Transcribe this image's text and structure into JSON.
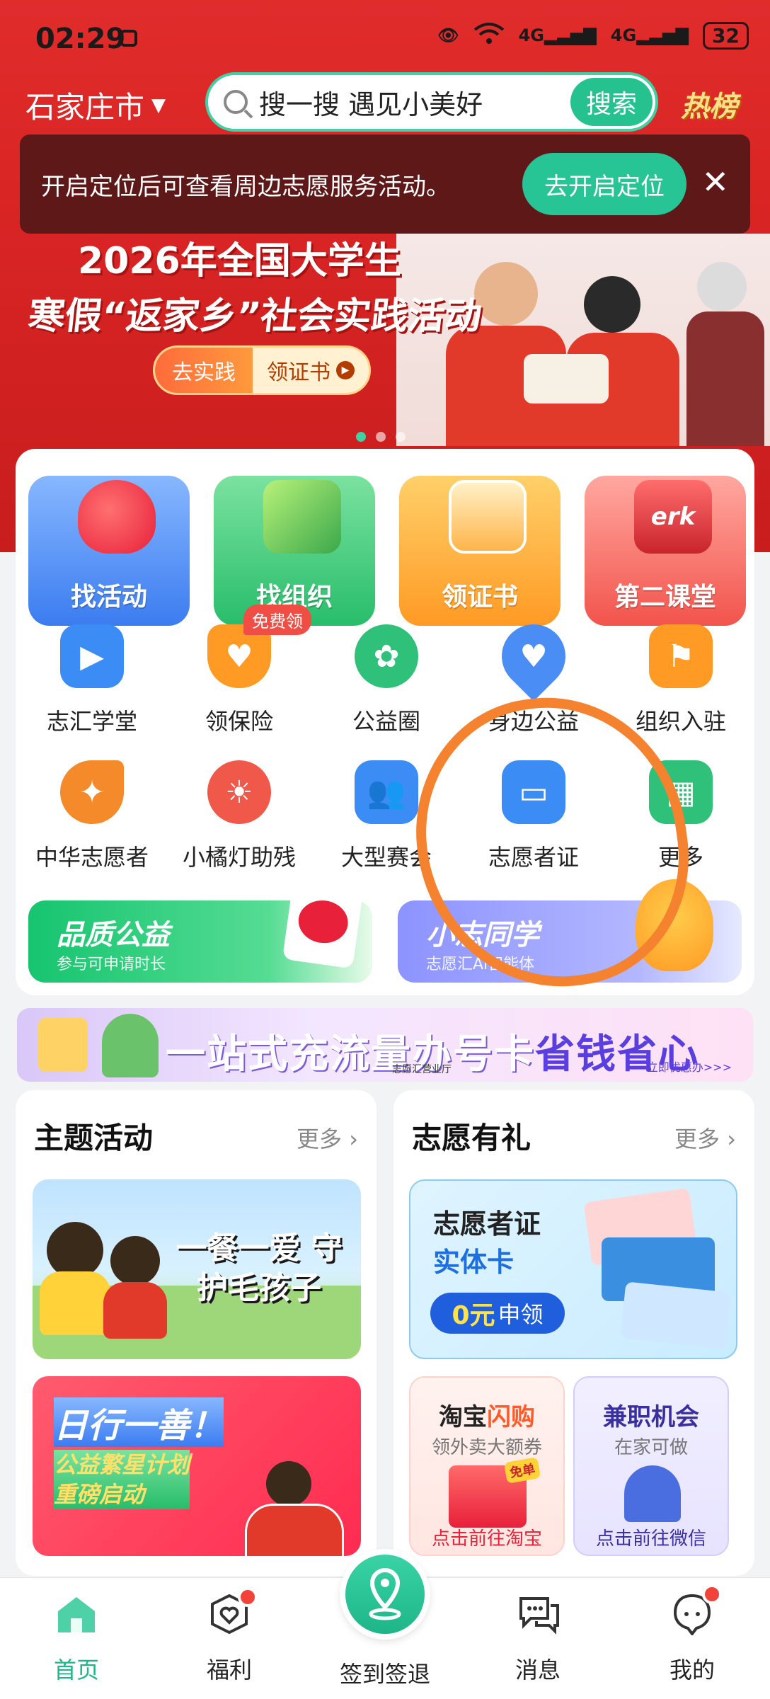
{
  "status": {
    "time": "02:29",
    "network": "4G",
    "battery": "32"
  },
  "header": {
    "city": "石家庄市",
    "search_placeholder": "搜一搜 遇见小美好",
    "search_button": "搜索",
    "hot_label": "热榜"
  },
  "notice": {
    "text": "开启定位后可查看周边志愿服务活动。",
    "button": "去开启定位"
  },
  "banner": {
    "title_line1": "2026年全国大学生",
    "title_line2": "寒假“返家乡”社会实践活动",
    "btn_practice": "去实践",
    "btn_cert": "领证书"
  },
  "tiles": [
    {
      "label": "找活动",
      "icon": "heart-icon"
    },
    {
      "label": "找组织",
      "icon": "megaphone-icon"
    },
    {
      "label": "领证书",
      "icon": "certificate-icon"
    },
    {
      "label": "第二课堂",
      "icon": "book-icon"
    }
  ],
  "grid": [
    {
      "label": "志汇学堂",
      "icon": "play-icon",
      "color": "#3b8df5"
    },
    {
      "label": "领保险",
      "icon": "shield-heart-icon",
      "color": "#ff9a24",
      "badge": "免费领"
    },
    {
      "label": "公益圈",
      "icon": "flower-icon",
      "color": "#2fc07a"
    },
    {
      "label": "身边公益",
      "icon": "location-heart-icon",
      "color": "#4a8ef5"
    },
    {
      "label": "组织入驻",
      "icon": "flag-icon",
      "color": "#ff9a24"
    },
    {
      "label": "中华志愿者",
      "icon": "bird-icon",
      "color": "#f48a2a"
    },
    {
      "label": "小橘灯助残",
      "icon": "sun-heart-icon",
      "color": "#f0584a"
    },
    {
      "label": "大型赛会",
      "icon": "people-icon",
      "color": "#3b8df5"
    },
    {
      "label": "志愿者证",
      "icon": "id-card-icon",
      "color": "#3b8df5"
    },
    {
      "label": "更多",
      "icon": "grid-icon",
      "color": "#2fc07a"
    }
  ],
  "promos": [
    {
      "title": "品质公益",
      "sub": "参与可申请时长"
    },
    {
      "title": "小志同学",
      "sub": "志愿汇Ai智能体"
    }
  ],
  "ad": {
    "text_a": "一站式充流量办号卡",
    "text_b": "省钱省心",
    "source": "志愿汇营业厅",
    "cta": "立即优惠办>>>"
  },
  "theme": {
    "title": "主题活动",
    "more": "更多",
    "card1": "一餐一爱 守护毛孩子",
    "card2_title": "日行一善！",
    "card2_sub1": "公益繁星计划",
    "card2_sub2": "重磅启动"
  },
  "gift": {
    "title": "志愿有礼",
    "more": "更多",
    "card_a": "志愿者证",
    "card_b": "实体卡",
    "apply_prefix": "0元",
    "apply": "申领",
    "taobao_a": "淘宝",
    "taobao_b": "闪购",
    "taobao_sub": "领外卖大额券",
    "taobao_tag": "免单",
    "taobao_foot": "点击前往淘宝",
    "job_title": "兼职机会",
    "job_sub": "在家可做",
    "job_foot": "点击前往微信"
  },
  "nav": [
    {
      "label": "首页",
      "icon": "home-icon"
    },
    {
      "label": "福利",
      "icon": "gift-heart-icon"
    },
    {
      "label": "签到签退",
      "icon": "location-pin-icon"
    },
    {
      "label": "消息",
      "icon": "chat-icon"
    },
    {
      "label": "我的",
      "icon": "profile-icon"
    }
  ],
  "colors": {
    "brand_green": "#25c28f",
    "header_red": "#d92424",
    "annotation_orange": "#f5822e"
  }
}
